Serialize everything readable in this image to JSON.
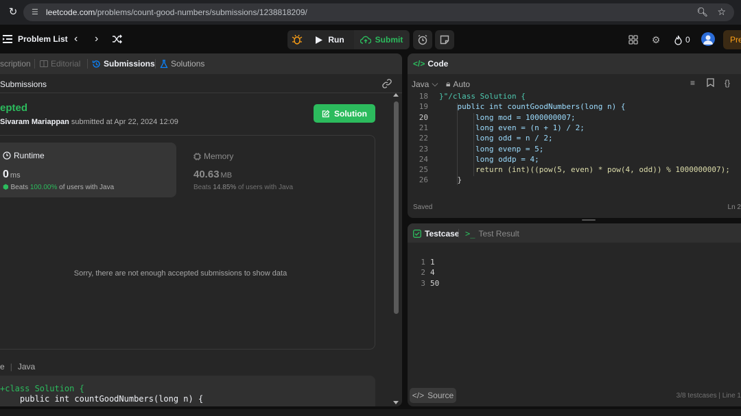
{
  "browser": {
    "url_host": "leetcode.com",
    "url_path": "/problems/count-good-numbers/submissions/1238818209/"
  },
  "nav": {
    "problem_list": "Problem List",
    "run": "Run",
    "submit": "Submit",
    "streak_count": "0",
    "premium_label": "Pre"
  },
  "left": {
    "tabs": [
      {
        "label": "scription"
      },
      {
        "label": "Editorial"
      },
      {
        "label": "Submissions"
      },
      {
        "label": "Solutions"
      }
    ],
    "sub_header": "Submissions",
    "status": "epted",
    "user": "Sivaram Mariappan",
    "submitted_at": " submitted at Apr 22, 2024 12:09",
    "solution_button": "Solution",
    "runtime": {
      "title": "Runtime",
      "value": "0",
      "unit": "ms",
      "beats_prefix": "Beats ",
      "beats_pct": "100.00%",
      "beats_suffix": " of users with Java"
    },
    "memory": {
      "title": "Memory",
      "value": "40.63",
      "unit": "MB",
      "beats_prefix": "Beats ",
      "beats_pct": "14.85%",
      "beats_suffix": " of users with Java"
    },
    "empty_message": "Sorry, there are not enough accepted submissions to show data",
    "language_prefix": "e",
    "language": "Java",
    "code_preview": [
      "+class Solution {",
      "    public int countGoodNumbers(long n) {"
    ]
  },
  "code_panel": {
    "title": "Code",
    "language": "Java",
    "mode": "Auto",
    "saved": "Saved",
    "cursor_pos": "Ln 2",
    "lines": [
      {
        "n": "18",
        "text": "}\"/class Solution {"
      },
      {
        "n": "19",
        "text": "    public int countGoodNumbers(long n) {"
      },
      {
        "n": "20",
        "text": "        long mod = 1000000007;"
      },
      {
        "n": "21",
        "text": "        long even = (n + 1) / 2;"
      },
      {
        "n": "22",
        "text": "        long odd = n / 2;"
      },
      {
        "n": "23",
        "text": "        long evenp = 5;"
      },
      {
        "n": "24",
        "text": "        long oddp = 4;"
      },
      {
        "n": "25",
        "text": "        return (int)((pow(5, even) * pow(4, odd)) % 1000000007);"
      },
      {
        "n": "26",
        "text": "    }"
      }
    ]
  },
  "test_panel": {
    "tab_testcase": "Testcase",
    "tab_result": "Test Result",
    "lines": [
      {
        "n": "1",
        "text": "1"
      },
      {
        "n": "2",
        "text": "4"
      },
      {
        "n": "3",
        "text": "50"
      }
    ],
    "source_button": "Source",
    "status": "3/8 testcases   |   Line 1"
  },
  "colors": {
    "accent_green": "#2cbb5d",
    "premium_orange": "#ffa116",
    "link_blue": "#0a84ff"
  }
}
